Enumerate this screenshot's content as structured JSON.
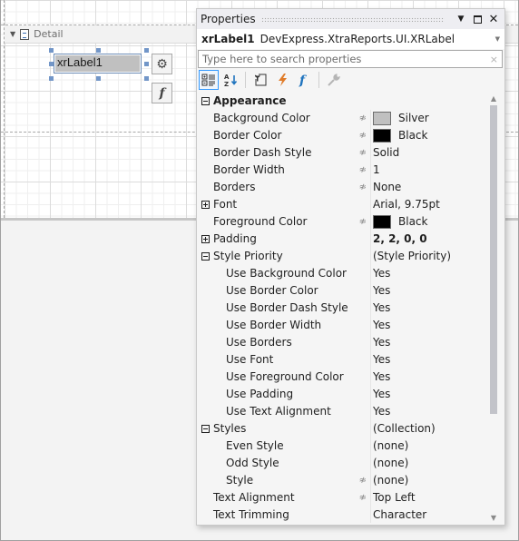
{
  "designer": {
    "band_label": "Detail",
    "label_text": "xrLabel1",
    "smart_tag_icon": "gear-icon",
    "expression_icon": "function-icon",
    "expression_glyph": "f"
  },
  "panel": {
    "title": "Properties",
    "buttons": {
      "pin": "▼",
      "close": "✕"
    },
    "object": {
      "name": "xrLabel1",
      "type": "DevExpress.XtraReports.UI.XRLabel"
    },
    "search": {
      "placeholder": "Type here to search properties",
      "value": "",
      "clear": "×"
    },
    "toolbar": [
      {
        "name": "categorized-icon",
        "active": true
      },
      {
        "name": "alphabetical-icon",
        "active": false
      },
      {
        "name": "properties-icon",
        "active": false
      },
      {
        "name": "events-icon",
        "active": false
      },
      {
        "name": "expressions-icon",
        "active": false
      },
      {
        "name": "wrench-icon",
        "active": false
      }
    ],
    "rows": [
      {
        "type": "category",
        "expander": "minus",
        "name": "Appearance",
        "value": ""
      },
      {
        "name": "Background Color",
        "mark": true,
        "swatch": "#c0c0c0",
        "value": "Silver"
      },
      {
        "name": "Border Color",
        "mark": true,
        "swatch": "#000000",
        "value": "Black"
      },
      {
        "name": "Border Dash Style",
        "mark": true,
        "value": "Solid"
      },
      {
        "name": "Border Width",
        "mark": true,
        "value": "1"
      },
      {
        "name": "Borders",
        "mark": true,
        "value": "None"
      },
      {
        "name": "Font",
        "expander": "plus",
        "value": "Arial, 9.75pt"
      },
      {
        "name": "Foreground Color",
        "mark": true,
        "swatch": "#000000",
        "value": "Black"
      },
      {
        "name": "Padding",
        "expander": "plus",
        "value": "2, 2, 0, 0",
        "bold": true
      },
      {
        "name": "Style Priority",
        "expander": "minus",
        "value": "(Style Priority)"
      },
      {
        "name": "Use Background Color",
        "indent": true,
        "value": "Yes"
      },
      {
        "name": "Use Border Color",
        "indent": true,
        "value": "Yes"
      },
      {
        "name": "Use Border Dash Style",
        "indent": true,
        "value": "Yes"
      },
      {
        "name": "Use Border Width",
        "indent": true,
        "value": "Yes"
      },
      {
        "name": "Use Borders",
        "indent": true,
        "value": "Yes"
      },
      {
        "name": "Use Font",
        "indent": true,
        "value": "Yes"
      },
      {
        "name": "Use Foreground Color",
        "indent": true,
        "value": "Yes"
      },
      {
        "name": "Use Padding",
        "indent": true,
        "value": "Yes"
      },
      {
        "name": "Use Text Alignment",
        "indent": true,
        "value": "Yes"
      },
      {
        "name": "Styles",
        "expander": "minus",
        "value": "(Collection)"
      },
      {
        "name": "Even Style",
        "indent": true,
        "value": "(none)"
      },
      {
        "name": "Odd Style",
        "indent": true,
        "value": "(none)"
      },
      {
        "name": "Style",
        "indent": true,
        "mark": true,
        "value": "(none)"
      },
      {
        "name": "Text Alignment",
        "mark": true,
        "value": "Top Left"
      },
      {
        "name": "Text Trimming",
        "value": "Character"
      }
    ],
    "expression_mark": "≉"
  }
}
